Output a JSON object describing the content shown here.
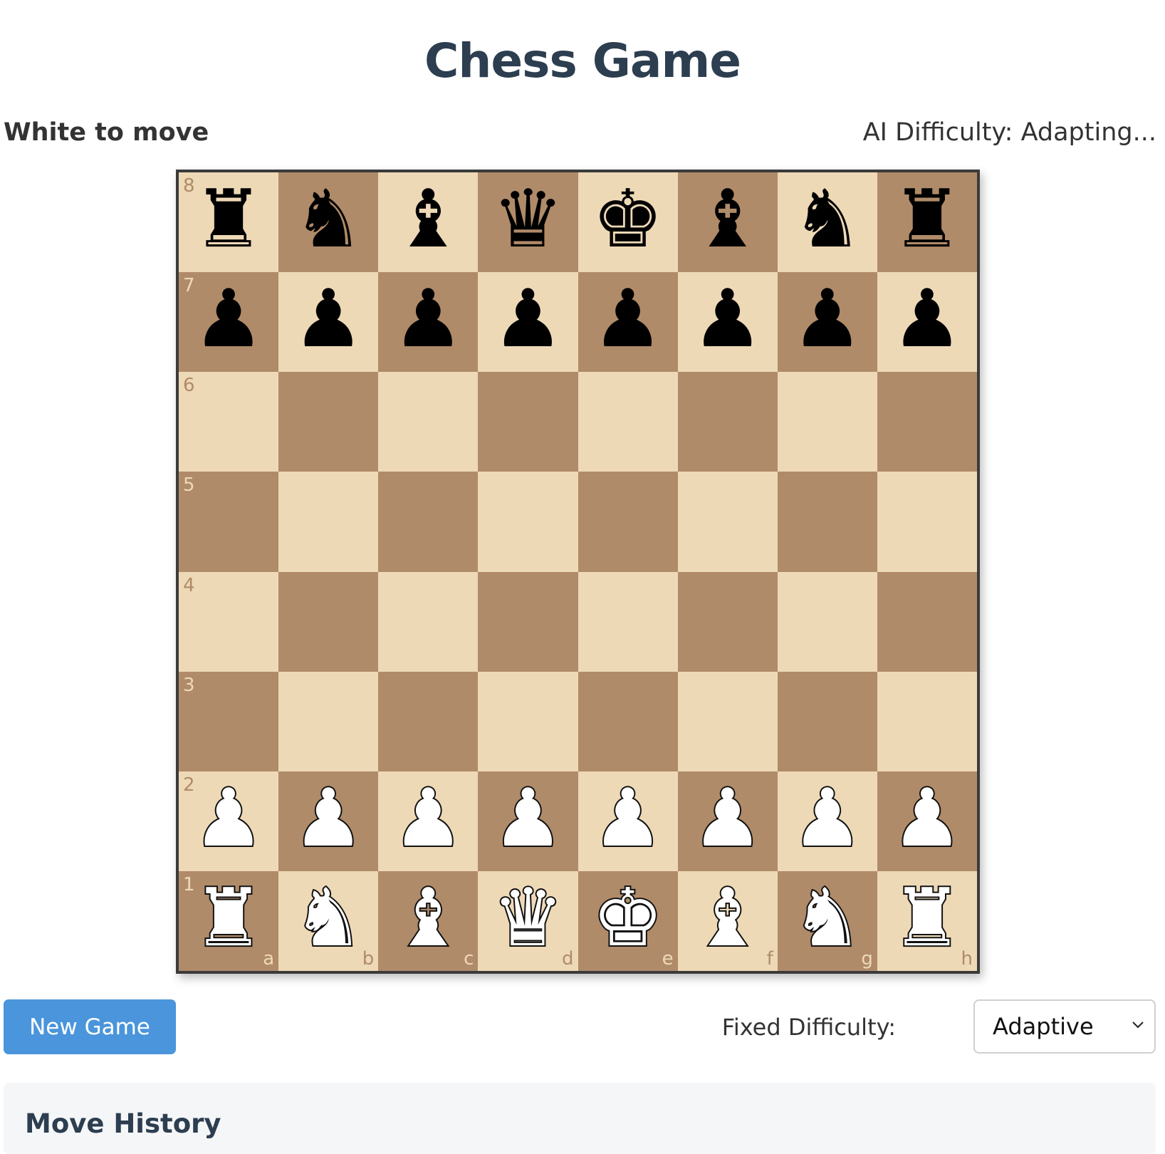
{
  "title": "Chess Game",
  "status": "White to move",
  "ai_difficulty": "AI Difficulty: Adapting...",
  "board": {
    "ranks": [
      "8",
      "7",
      "6",
      "5",
      "4",
      "3",
      "2",
      "1"
    ],
    "files": [
      "a",
      "b",
      "c",
      "d",
      "e",
      "f",
      "g",
      "h"
    ],
    "rows": [
      [
        "bR",
        "bN",
        "bB",
        "bQ",
        "bK",
        "bB",
        "bN",
        "bR"
      ],
      [
        "bP",
        "bP",
        "bP",
        "bP",
        "bP",
        "bP",
        "bP",
        "bP"
      ],
      [
        "",
        "",
        "",
        "",
        "",
        "",
        "",
        ""
      ],
      [
        "",
        "",
        "",
        "",
        "",
        "",
        "",
        ""
      ],
      [
        "",
        "",
        "",
        "",
        "",
        "",
        "",
        ""
      ],
      [
        "",
        "",
        "",
        "",
        "",
        "",
        "",
        ""
      ],
      [
        "wP",
        "wP",
        "wP",
        "wP",
        "wP",
        "wP",
        "wP",
        "wP"
      ],
      [
        "wR",
        "wN",
        "wB",
        "wQ",
        "wK",
        "wB",
        "wN",
        "wR"
      ]
    ],
    "light_color": "#eed9b7",
    "dark_color": "#b08b69"
  },
  "controls": {
    "new_game_label": "New Game",
    "new_game_color": "#4a95db",
    "fixed_difficulty_label": "Fixed Difficulty:",
    "fixed_difficulty_value": "Adaptive"
  },
  "history": {
    "title": "Move History"
  }
}
